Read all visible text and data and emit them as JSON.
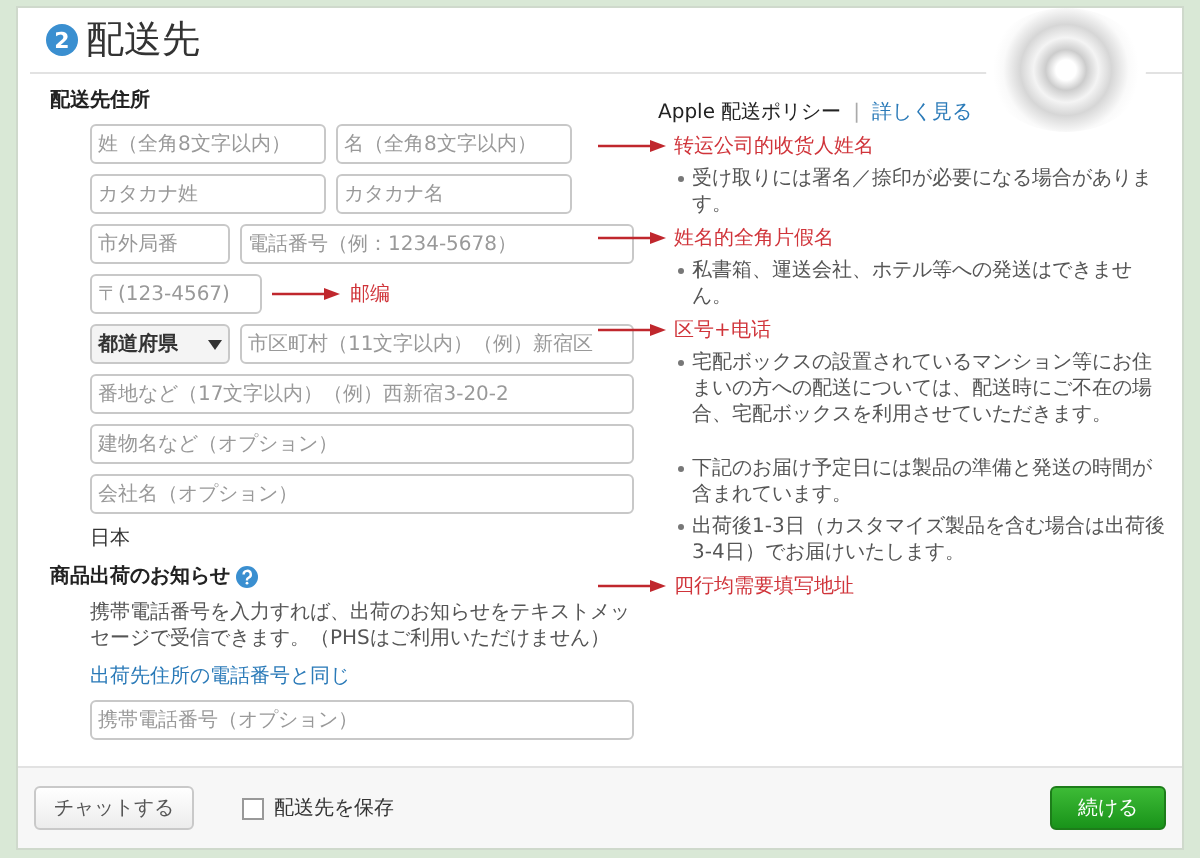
{
  "header": {
    "step": "2",
    "title": "配送先"
  },
  "address": {
    "heading": "配送先住所",
    "rows": [
      {
        "fields": [
          {
            "kind": "half",
            "placeholder": "姓（全角8文字以内）"
          },
          {
            "kind": "half",
            "placeholder": "名（全角8文字以内）"
          }
        ]
      },
      {
        "fields": [
          {
            "kind": "half",
            "placeholder": "カタカナ姓"
          },
          {
            "kind": "half",
            "placeholder": "カタカナ名"
          }
        ]
      },
      {
        "fields": [
          {
            "kind": "short",
            "placeholder": "市外局番"
          },
          {
            "kind": "wide",
            "placeholder": "電話番号（例：1234-5678）"
          }
        ]
      },
      {
        "fields": [
          {
            "kind": "zip",
            "placeholder": "〒(123-4567)"
          }
        ],
        "annotation": "邮编"
      },
      {
        "fields": [
          {
            "kind": "select",
            "value": "都道府県"
          },
          {
            "kind": "wide",
            "placeholder": "市区町村（11文字以内）（例）新宿区"
          }
        ]
      },
      {
        "fields": [
          {
            "kind": "wide",
            "placeholder": "番地など（17文字以内）（例）西新宿3-20-2"
          }
        ]
      },
      {
        "fields": [
          {
            "kind": "wide",
            "placeholder": "建物名など（オプション）"
          }
        ]
      },
      {
        "fields": [
          {
            "kind": "wide",
            "placeholder": "会社名（オプション）"
          }
        ]
      }
    ],
    "country": "日本"
  },
  "notification": {
    "heading": "商品出荷のお知らせ",
    "description": "携帯電話番号を入力すれば、出荷のお知らせをテキストメッセージで受信できます。（PHSはご利用いただけません）",
    "link": "出荷先住所の電話番号と同じ",
    "field": {
      "placeholder": "携帯電話番号（オプション）"
    }
  },
  "policy": {
    "title": "Apple 配送ポリシー",
    "separator": "|",
    "link": "詳しく見る",
    "items": [
      {
        "kind": "annotation",
        "text": "转运公司的收货人姓名"
      },
      {
        "kind": "bullet",
        "text": "受け取りには署名／捺印が必要になる場合があります。"
      },
      {
        "kind": "annotation",
        "text": "姓名的全角片假名"
      },
      {
        "kind": "bullet",
        "text": "私書箱、運送会社、ホテル等への発送はできません。"
      },
      {
        "kind": "annotation",
        "text": "区号+电话"
      },
      {
        "kind": "bullet",
        "text": "宅配ボックスの設置されているマンション等にお住まいの方への配送については、配送時にご不在の場合、宅配ボックスを利用させていただきます。"
      },
      {
        "kind": "gap"
      },
      {
        "kind": "bullet",
        "text": "下記のお届け予定日には製品の準備と発送の時間が含まれています。"
      },
      {
        "kind": "bullet",
        "text": "出荷後1-3日（カスタマイズ製品を含む場合は出荷後3-4日）でお届けいたします。"
      },
      {
        "kind": "annotation",
        "text": "四行均需要填写地址"
      }
    ]
  },
  "footer": {
    "chat_button": "チャットする",
    "save": {
      "label": "配送先を保存",
      "checked": false
    },
    "continue_button": "続ける"
  }
}
